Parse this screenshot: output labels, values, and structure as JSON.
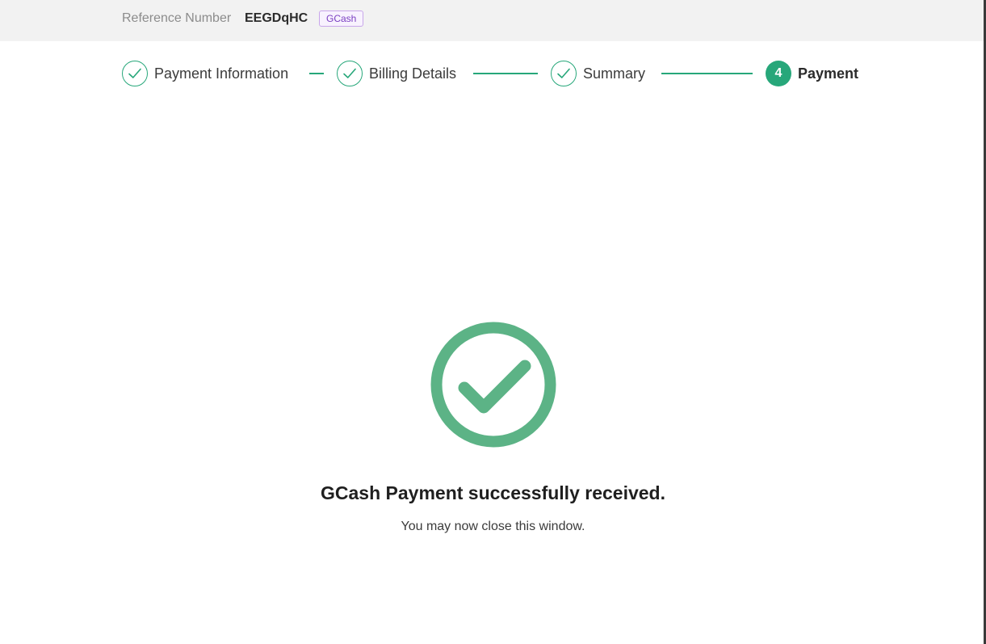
{
  "header": {
    "reference_label": "Reference Number",
    "reference_value": "EEGDqHC",
    "payment_method_badge": "GCash"
  },
  "stepper": {
    "steps": [
      {
        "label": "Payment Information",
        "status": "completed"
      },
      {
        "label": "Billing Details",
        "status": "completed"
      },
      {
        "label": "Summary",
        "status": "completed"
      },
      {
        "label": "Payment",
        "status": "active",
        "number": "4"
      }
    ]
  },
  "result": {
    "icon": "check-circle-icon",
    "title": "GCash Payment successfully received.",
    "message": "You may now close this window."
  },
  "colors": {
    "accent_green": "#27a77a",
    "success_icon_green": "#5cb386",
    "badge_purple": "#7b3fc2",
    "topbar_background": "#f2f2f2"
  }
}
